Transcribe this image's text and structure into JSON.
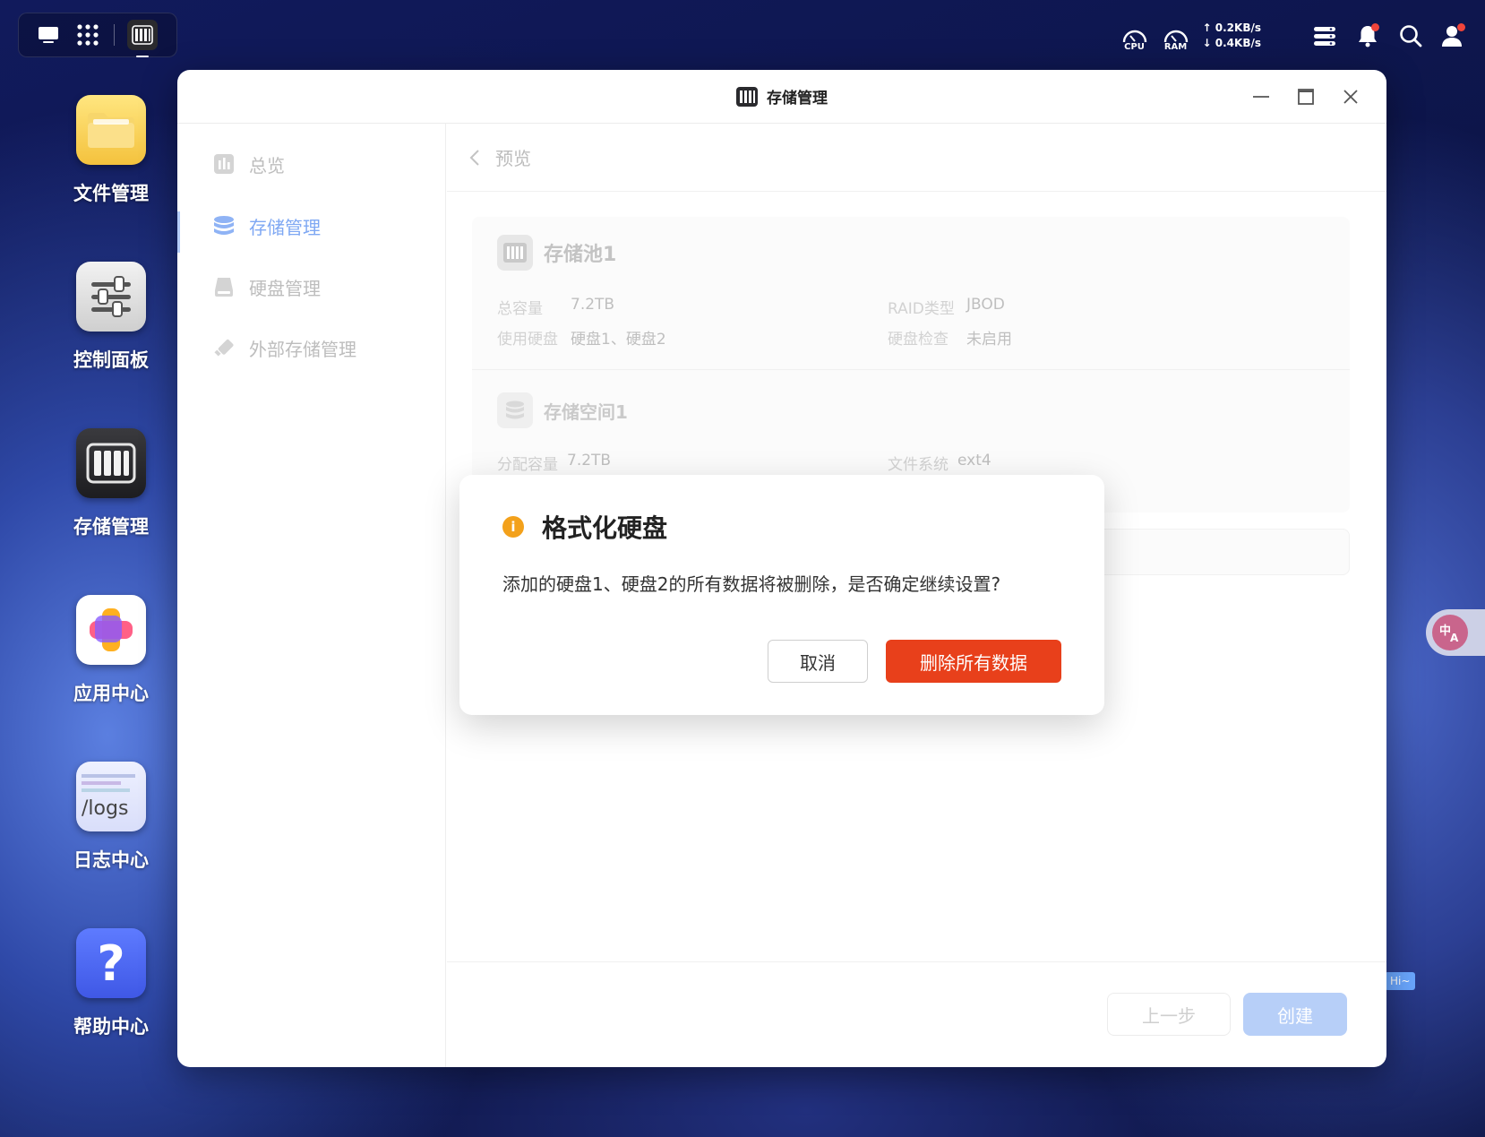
{
  "topbar": {
    "cpu_label": "CPU",
    "ram_label": "RAM",
    "upload": "↑ 0.2KB/s",
    "download": "↓ 0.4KB/s"
  },
  "dock": [
    {
      "label": "文件管理",
      "icon": "folder-icon"
    },
    {
      "label": "控制面板",
      "icon": "sliders-icon"
    },
    {
      "label": "存储管理",
      "icon": "storage-icon"
    },
    {
      "label": "应用中心",
      "icon": "app-center-icon"
    },
    {
      "label": "日志中心",
      "icon": "logs-icon",
      "icon_text": "/logs"
    },
    {
      "label": "帮助中心",
      "icon": "help-icon",
      "icon_text": "?"
    }
  ],
  "window": {
    "title": "存储管理"
  },
  "sidebar": {
    "items": [
      {
        "label": "总览",
        "icon": "chart-icon",
        "active": false
      },
      {
        "label": "存储管理",
        "icon": "database-icon",
        "active": true
      },
      {
        "label": "硬盘管理",
        "icon": "disk-icon",
        "active": false
      },
      {
        "label": "外部存储管理",
        "icon": "usb-icon",
        "active": false
      }
    ]
  },
  "main": {
    "breadcrumb": "预览",
    "pool": {
      "title": "存储池1",
      "total_capacity_label": "总容量",
      "total_capacity": "7.2TB",
      "raid_label": "RAID类型",
      "raid": "JBOD",
      "disks_label": "使用硬盘",
      "disks": "硬盘1、硬盘2",
      "check_label": "硬盘检查",
      "check": "未启用"
    },
    "space": {
      "title": "存储空间1",
      "alloc_label": "分配容量",
      "alloc": "7.2TB",
      "fs_label": "文件系统",
      "fs": "ext4"
    },
    "prev_button": "上一步",
    "create_button": "创建"
  },
  "dialog": {
    "title": "格式化硬盘",
    "message": "添加的硬盘1、硬盘2的所有数据将被删除，是否确定继续设置?",
    "cancel": "取消",
    "confirm": "删除所有数据"
  },
  "floating": {
    "hi_tag": "Hi~",
    "translate_icon": "translate-icon"
  },
  "colors": {
    "accent": "#7fa8f3",
    "danger": "#e8401b",
    "warning": "#f3a11b"
  }
}
